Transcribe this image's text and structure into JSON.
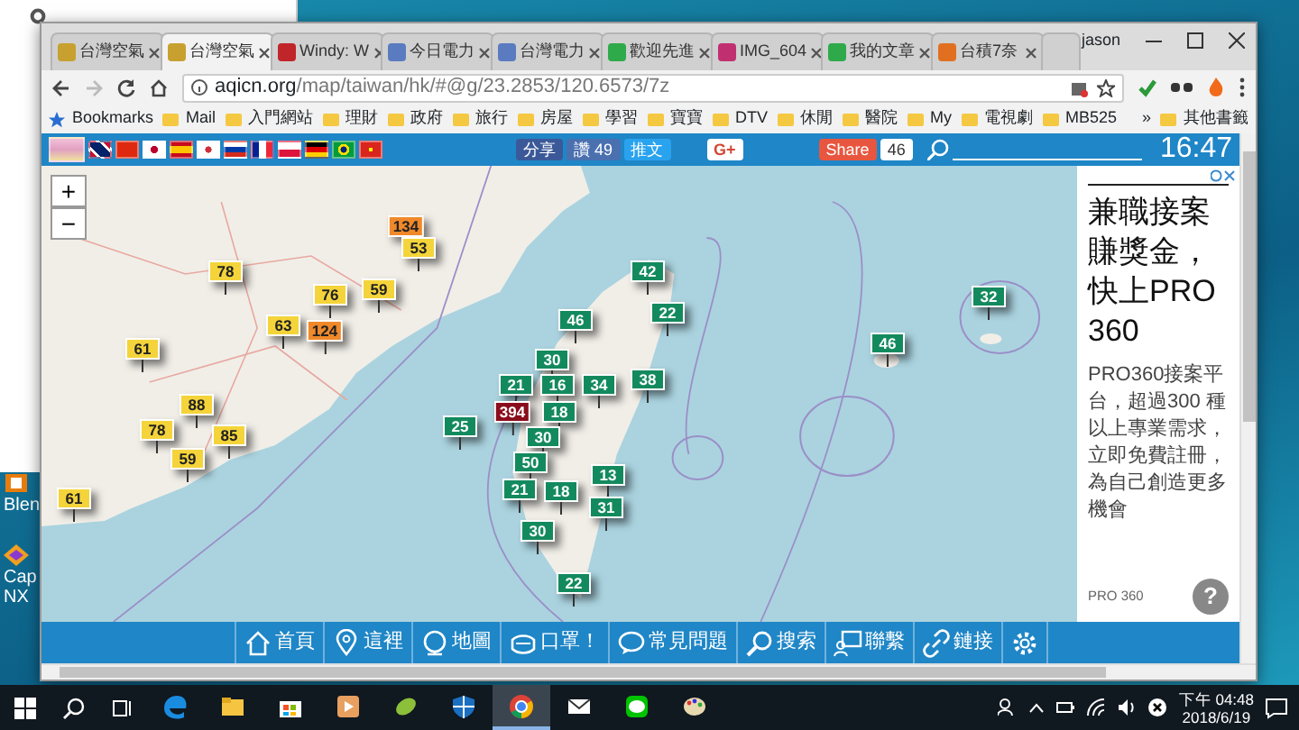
{
  "desktop": {
    "icons": [
      "Blen",
      "Cap NX"
    ]
  },
  "browser": {
    "profile": "jason",
    "tabs": [
      {
        "title": "台灣空氣",
        "selected": false
      },
      {
        "title": "台灣空氣",
        "selected": true
      },
      {
        "title": "Windy: W",
        "selected": false
      },
      {
        "title": "今日電力",
        "selected": false
      },
      {
        "title": "台灣電力",
        "selected": false
      },
      {
        "title": "歡迎先進",
        "selected": false
      },
      {
        "title": "IMG_604",
        "selected": false
      },
      {
        "title": "我的文章",
        "selected": false
      },
      {
        "title": "台積7奈",
        "selected": false
      }
    ],
    "address": {
      "domain": "aqicn.org",
      "path": "/map/taiwan/hk/#@g/23.2853/120.6573/7z"
    },
    "bookmarks": [
      "Bookmarks",
      "Mail",
      "入門網站",
      "理財",
      "政府",
      "旅行",
      "房屋",
      "學習",
      "寶寶",
      "DTV",
      "休閒",
      "醫院",
      "My",
      "電視劇",
      "MB525"
    ],
    "bookmarks_more": "»",
    "other_bookmarks": "其他書籤"
  },
  "site_bar": {
    "share": "分享",
    "like": "讚 49",
    "tweet": "推文",
    "gplus": "G+",
    "share_button": "Share",
    "share_count": "46",
    "clock": "16:47"
  },
  "map": {
    "zoom_in": "+",
    "zoom_out": "−",
    "markers": [
      {
        "value": "134",
        "color": "#f0892a"
      },
      {
        "value": "53",
        "color": "#f4d43a"
      },
      {
        "value": "78",
        "color": "#f4d43a"
      },
      {
        "value": "42",
        "color": "#138a5e"
      },
      {
        "value": "76",
        "color": "#f4d43a"
      },
      {
        "value": "59",
        "color": "#f4d43a"
      },
      {
        "value": "32",
        "color": "#138a5e"
      },
      {
        "value": "46",
        "color": "#138a5e"
      },
      {
        "value": "22",
        "color": "#138a5e"
      },
      {
        "value": "63",
        "color": "#f4d43a"
      },
      {
        "value": "124",
        "color": "#f0892a"
      },
      {
        "value": "61",
        "color": "#f4d43a"
      },
      {
        "value": "46",
        "color": "#138a5e"
      },
      {
        "value": "30",
        "color": "#138a5e"
      },
      {
        "value": "21",
        "color": "#138a5e"
      },
      {
        "value": "16",
        "color": "#138a5e"
      },
      {
        "value": "34",
        "color": "#138a5e"
      },
      {
        "value": "38",
        "color": "#138a5e"
      },
      {
        "value": "88",
        "color": "#f4d43a"
      },
      {
        "value": "394",
        "color": "#8a0d1c"
      },
      {
        "value": "18",
        "color": "#138a5e"
      },
      {
        "value": "78",
        "color": "#f4d43a"
      },
      {
        "value": "85",
        "color": "#f4d43a"
      },
      {
        "value": "25",
        "color": "#138a5e"
      },
      {
        "value": "30",
        "color": "#138a5e"
      },
      {
        "value": "59",
        "color": "#f4d43a"
      },
      {
        "value": "50",
        "color": "#138a5e"
      },
      {
        "value": "13",
        "color": "#138a5e"
      },
      {
        "value": "21",
        "color": "#138a5e"
      },
      {
        "value": "18",
        "color": "#138a5e"
      },
      {
        "value": "61",
        "color": "#f4d43a"
      },
      {
        "value": "31",
        "color": "#138a5e"
      },
      {
        "value": "30",
        "color": "#138a5e"
      },
      {
        "value": "22",
        "color": "#138a5e"
      }
    ]
  },
  "ad": {
    "headline": "兼職接案賺獎金，快上PRO360",
    "body": "PRO360接案平台，超過300 種以上專業需求，立即免費註冊，為自己創造更多機會",
    "advertiser": "PRO 360",
    "help": "?"
  },
  "nav": [
    {
      "kind": "home",
      "label": "首頁"
    },
    {
      "kind": "pin",
      "label": "這裡"
    },
    {
      "kind": "globe",
      "label": "地圖"
    },
    {
      "kind": "mask",
      "label": "口罩！"
    },
    {
      "kind": "chat",
      "label": "常見問題"
    },
    {
      "kind": "search",
      "label": "搜索"
    },
    {
      "kind": "contact",
      "label": "聯繫"
    },
    {
      "kind": "link",
      "label": "鏈接"
    },
    {
      "kind": "settings"
    }
  ],
  "taskbar": {
    "apps": [
      {
        "kind": "edge",
        "active": false
      },
      {
        "kind": "folder",
        "active": false
      },
      {
        "kind": "store",
        "active": false
      },
      {
        "kind": "media",
        "active": false
      },
      {
        "kind": "leaf",
        "active": false
      },
      {
        "kind": "shield",
        "active": false
      },
      {
        "kind": "chrome",
        "active": true
      },
      {
        "kind": "mail",
        "active": false
      },
      {
        "kind": "line",
        "active": false
      },
      {
        "kind": "paint",
        "active": false
      }
    ],
    "time": "下午 04:48",
    "date": "2018/6/19"
  }
}
